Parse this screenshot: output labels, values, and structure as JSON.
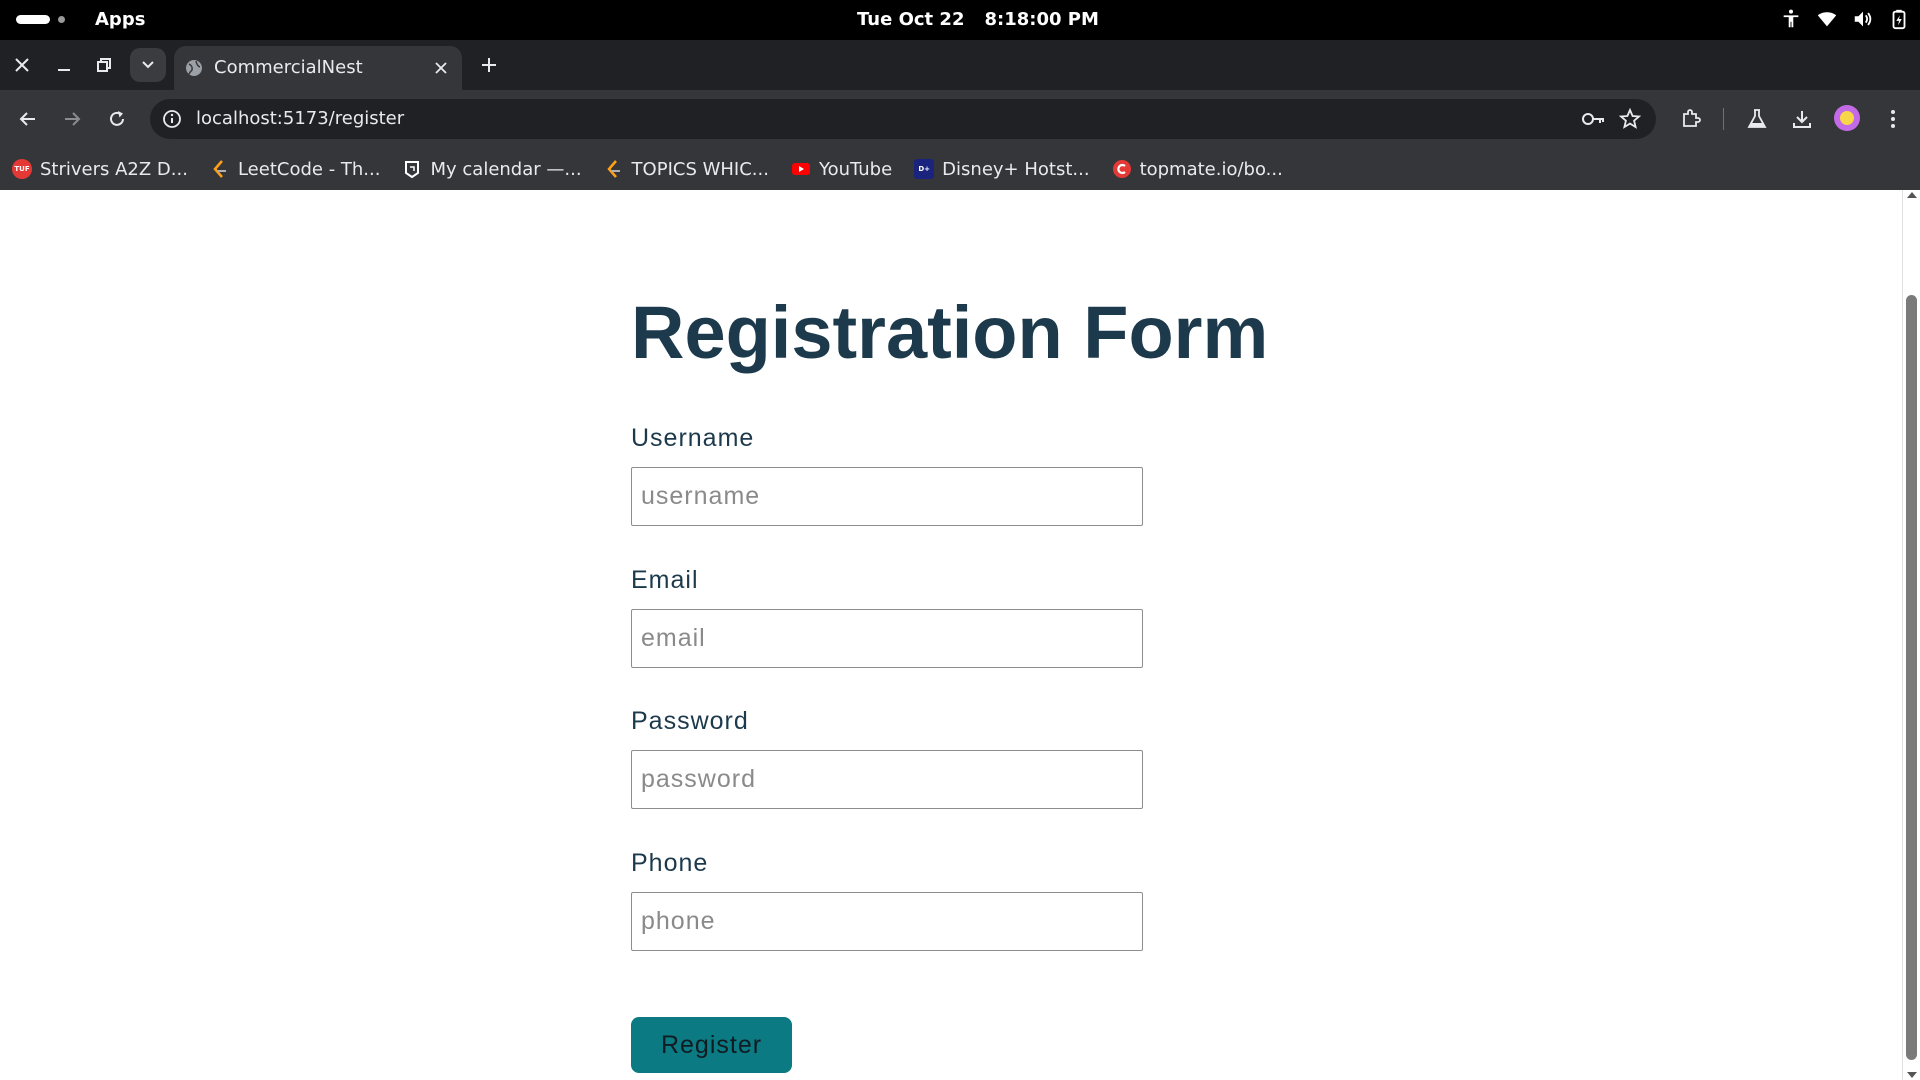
{
  "system_bar": {
    "apps_label": "Apps",
    "date": "Tue Oct 22",
    "time": "8:18:00 PM"
  },
  "browser": {
    "active_tab_title": "CommercialNest",
    "url": "localhost:5173/register",
    "bookmarks": [
      {
        "label": "Strivers A2Z D...",
        "icon": "tuf-icon",
        "color": "#e53935"
      },
      {
        "label": "LeetCode - Th...",
        "icon": "leetcode-icon",
        "color": "#ffa116"
      },
      {
        "label": "My calendar —...",
        "icon": "calendar-icon",
        "color": "#ffffff"
      },
      {
        "label": "TOPICS WHIC...",
        "icon": "leetcode-icon",
        "color": "#ffa116"
      },
      {
        "label": "YouTube",
        "icon": "youtube-icon",
        "color": "#ff0000"
      },
      {
        "label": "Disney+ Hotst...",
        "icon": "hotstar-icon",
        "color": "#1a237e"
      },
      {
        "label": "topmate.io/bo...",
        "icon": "topmate-icon",
        "color": "#e53935"
      }
    ]
  },
  "page": {
    "title": "Registration Form",
    "fields": {
      "username": {
        "label": "Username",
        "placeholder": "username"
      },
      "email": {
        "label": "Email",
        "placeholder": "email"
      },
      "password": {
        "label": "Password",
        "placeholder": "password"
      },
      "phone": {
        "label": "Phone",
        "placeholder": "phone"
      }
    },
    "submit_label": "Register"
  },
  "colors": {
    "heading": "#1d3a4c",
    "button": "#0b7a82",
    "chrome_frame": "#35363a"
  }
}
